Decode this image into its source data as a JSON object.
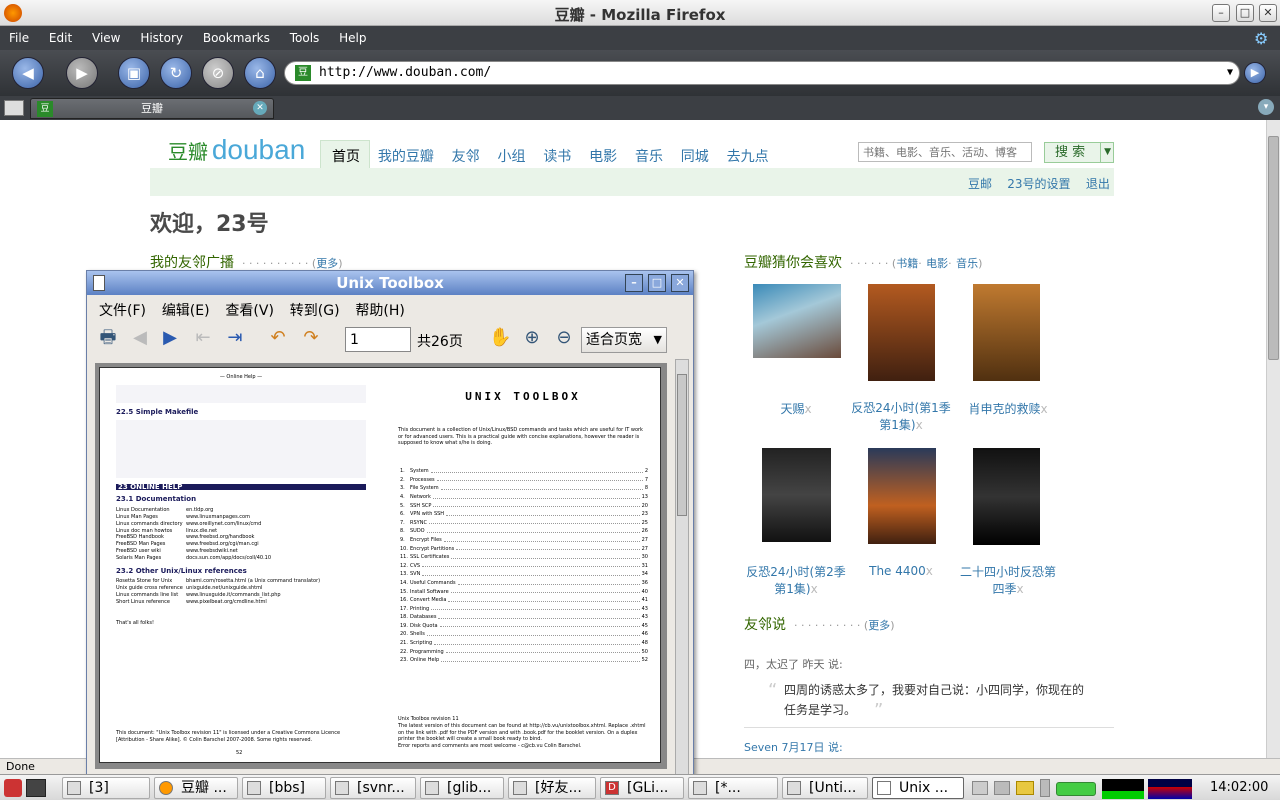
{
  "window": {
    "title": "豆瓣  - Mozilla Firefox"
  },
  "menu": [
    "File",
    "Edit",
    "View",
    "History",
    "Bookmarks",
    "Tools",
    "Help"
  ],
  "url": "http://www.douban.com/",
  "tab": {
    "label": "豆瓣"
  },
  "site": {
    "logo_cn": "豆瓣",
    "logo_en": "douban",
    "nav": [
      "首页",
      "我的豆瓣",
      "友邻",
      "小组",
      "读书",
      "电影",
      "音乐",
      "同城",
      "去九点"
    ],
    "search_placeholder": "书籍、电影、音乐、活动、博客",
    "search_btn": "搜 索",
    "user_links": [
      "豆邮",
      "23号的设置",
      "退出"
    ],
    "welcome": "欢迎，23号",
    "friends_feed": "我的友邻广播",
    "more": "更多",
    "guess_title": "豆瓣猜你会喜欢",
    "guess_links": [
      "书籍",
      "电影",
      "音乐"
    ],
    "movies": [
      {
        "title": "天赐",
        "x": "x"
      },
      {
        "title": "反恐24小时(第1季第1集)",
        "x": "x"
      },
      {
        "title": "肖申克的救赎",
        "x": "x"
      },
      {
        "title": "反恐24小时(第2季第1集)",
        "x": "x"
      },
      {
        "title": "The 4400",
        "x": "x"
      },
      {
        "title": "二十四小时反恐第四季",
        "x": "x"
      }
    ],
    "friends_say": "友邻说",
    "post1_author": "四，太迟了 昨天 说:",
    "post1_text": "四周的诱惑太多了，我要对自己说：小四同学，你现在的任务是学习。",
    "post2_author": "Seven 7月17日 说:"
  },
  "utw": {
    "title": "Unix Toolbox",
    "menu": [
      "文件(F)",
      "编辑(E)",
      "查看(V)",
      "转到(G)",
      "帮助(H)"
    ],
    "page": "1",
    "total": "共26页",
    "zoom": "适合页宽",
    "left": {
      "head": "— Online Help —",
      "h1": "22.5 Simple Makefile",
      "h2": "23 ONLINE HELP",
      "h3": "23.1 Documentation",
      "docs": [
        [
          "Linux Documentation",
          "en.tldp.org"
        ],
        [
          "Linux Man Pages",
          "www.linuxmanpages.com"
        ],
        [
          "Linux commands directory",
          "www.oreillynet.com/linux/cmd"
        ],
        [
          "Linux doc man howtos",
          "linux.die.net"
        ],
        [
          "FreeBSD Handbook",
          "www.freebsd.org/handbook"
        ],
        [
          "FreeBSD Man Pages",
          "www.freebsd.org/cgi/man.cgi"
        ],
        [
          "FreeBSD user wiki",
          "www.freebsdwiki.net"
        ],
        [
          "Solaris Man Pages",
          "docs.sun.com/app/docs/coll/40.10"
        ]
      ],
      "h4": "23.2 Other Unix/Linux references",
      "refs": [
        [
          "Rosetta Stone for Unix",
          "bhami.com/rosetta.html (a Unix command translator)"
        ],
        [
          "Unix guide cross reference",
          "unixguide.net/unixguide.shtml"
        ],
        [
          "Linux commands line list",
          "www.linuxguide.it/commands_list.php"
        ],
        [
          "Short Linux reference",
          "www.pixelbeat.org/cmdline.html"
        ]
      ],
      "end": "That's all folks!",
      "license": "This document: \"Unix Toolbox revision 11\" is licensed under a Creative Commons Licence [Attribution - Share Alike]. © Colin Barschel 2007-2008. Some rights reserved.",
      "pageno": "52"
    },
    "right": {
      "title": "UNIX TOOLBOX",
      "intro": "This document is a collection of Unix/Linux/BSD commands and tasks which are useful for IT work or for advanced users. This is a practical guide with concise explanations, however the reader is supposed to know what s/he is doing.",
      "toc": [
        [
          "1.",
          "System",
          "2"
        ],
        [
          "2.",
          "Processes",
          "7"
        ],
        [
          "3.",
          "File System",
          "8"
        ],
        [
          "4.",
          "Network",
          "13"
        ],
        [
          "5.",
          "SSH SCP",
          "20"
        ],
        [
          "6.",
          "VPN with SSH",
          "23"
        ],
        [
          "7.",
          "RSYNC",
          "25"
        ],
        [
          "8.",
          "SUDO",
          "26"
        ],
        [
          "9.",
          "Encrypt Files",
          "27"
        ],
        [
          "10.",
          "Encrypt Partitions",
          "27"
        ],
        [
          "11.",
          "SSL Certificates",
          "30"
        ],
        [
          "12.",
          "CVS",
          "31"
        ],
        [
          "13.",
          "SVN",
          "34"
        ],
        [
          "14.",
          "Useful Commands",
          "36"
        ],
        [
          "15.",
          "Install Software",
          "40"
        ],
        [
          "16.",
          "Convert Media",
          "41"
        ],
        [
          "17.",
          "Printing",
          "43"
        ],
        [
          "18.",
          "Databases",
          "43"
        ],
        [
          "19.",
          "Disk Quota",
          "45"
        ],
        [
          "20.",
          "Shells",
          "46"
        ],
        [
          "21.",
          "Scripting",
          "48"
        ],
        [
          "22.",
          "Programming",
          "50"
        ],
        [
          "23.",
          "Online Help",
          "52"
        ]
      ],
      "footer": "Unix Toolbox revision 11\nThe latest version of this document can be found at http://cb.vu/unixtoolbox.xhtml. Replace .xhtml on the link with .pdf for the PDF version and with .book.pdf for the booklet version. On a duplex printer the booklet will create a small book ready to bind.\nError reports and comments are most welcome - c@cb.vu Colin Barschel."
    }
  },
  "status": "Done",
  "taskbar": [
    "[3]",
    "豆瓣 ...",
    "[bbs]",
    "[svnr...",
    "[glib...",
    "[好友...",
    "[GLi...",
    "[*...",
    "[Unti...",
    "Unix ..."
  ],
  "clock": "14:02:00"
}
